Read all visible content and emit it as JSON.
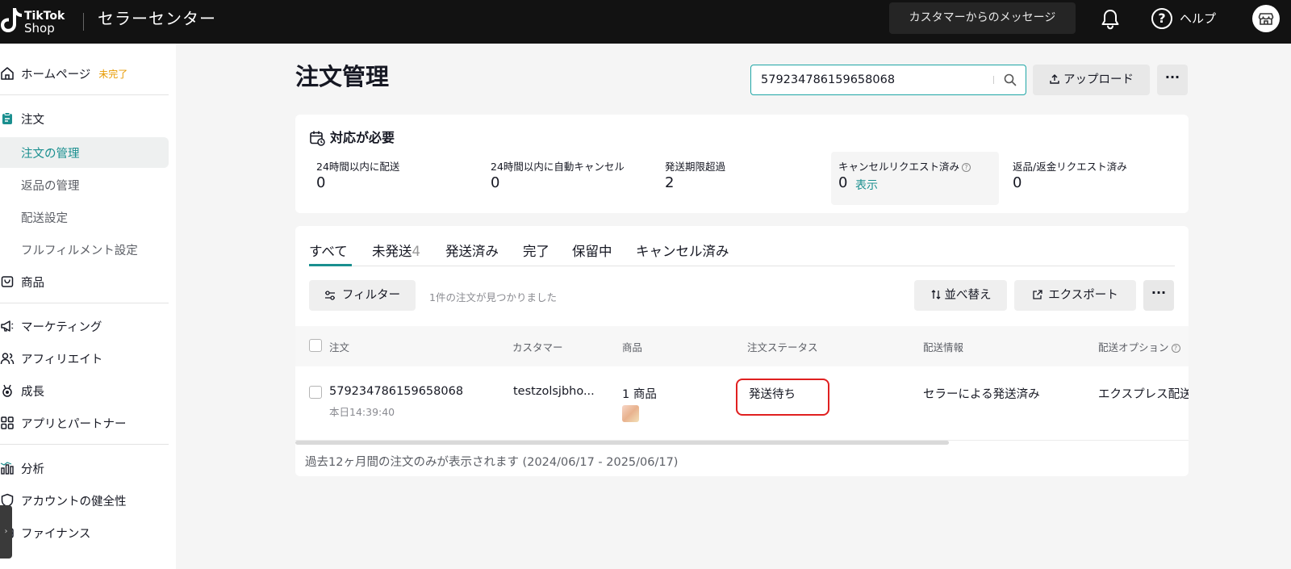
{
  "header": {
    "brand_line1": "TikTok",
    "brand_line2": "Shop",
    "title": "セラーセンター",
    "messages_button": "カスタマーからのメッセージ",
    "help_label": "ヘルプ"
  },
  "sidebar": {
    "home": "ホームページ",
    "home_badge": "未完了",
    "orders": "注文",
    "order_items": [
      "注文の管理",
      "返品の管理",
      "配送設定",
      "フルフィルメント設定"
    ],
    "products": "商品",
    "marketing": "マーケティング",
    "affiliate": "アフィリエイト",
    "growth": "成長",
    "apps": "アプリとパートナー",
    "analytics": "分析",
    "account_health": "アカウントの健全性",
    "finance": "ファイナンス"
  },
  "main": {
    "page_title": "注文管理",
    "search_value": "579234786159658068",
    "upload_button": "アップロード",
    "more_label": "···",
    "action_required": {
      "title": "対応が必要",
      "stats": [
        {
          "label": "24時間以内に配送",
          "value": "0"
        },
        {
          "label": "24時間以内に自動キャンセル",
          "value": "0"
        },
        {
          "label": "発送期限超過",
          "value": "2"
        },
        {
          "label": "キャンセルリクエスト済み",
          "value": "0",
          "link": "表示"
        },
        {
          "label": "返品/返金リクエスト済み",
          "value": "0"
        }
      ]
    },
    "tabs": [
      {
        "label": "すべて"
      },
      {
        "label": "未発送",
        "count": "4"
      },
      {
        "label": "発送済み"
      },
      {
        "label": "完了"
      },
      {
        "label": "保留中"
      },
      {
        "label": "キャンセル済み"
      }
    ],
    "filter_button": "フィルター",
    "found_text": "1件の注文が見つかりました",
    "sort_button": "並べ替え",
    "export_button": "エクスポート",
    "table": {
      "columns": [
        "注文",
        "カスタマー",
        "商品",
        "注文ステータス",
        "配送情報",
        "配送オプション"
      ],
      "rows": [
        {
          "order_id": "579234786159658068",
          "order_time": "本日14:39:40",
          "customer": "testzolsjbho...",
          "products": "1 商品",
          "status": "発送待ち",
          "shipping_info": "セラーによる発送済み",
          "shipping_option": "エクスプレス配送"
        }
      ]
    },
    "footer_note": "過去12ヶ月間の注文のみが表示されます (2024/06/17 - 2025/06/17)"
  },
  "colors": {
    "accent": "#1a8f8f",
    "warning": "#e79a00",
    "highlight_border": "#e02020",
    "topbar": "#121212"
  }
}
